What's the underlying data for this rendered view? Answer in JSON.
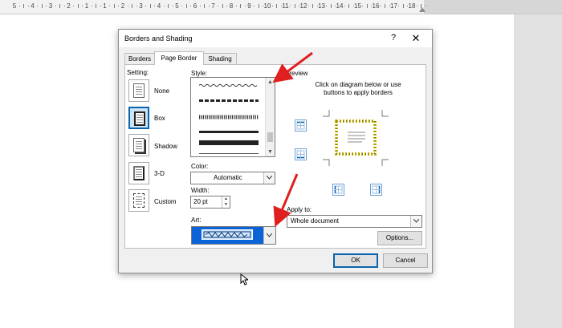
{
  "ruler": {
    "numbers": [
      "5",
      "4",
      "3",
      "2",
      "1",
      "1",
      "2",
      "3",
      "4",
      "5",
      "6",
      "7",
      "8",
      "9",
      "10",
      "11",
      "12",
      "13",
      "14",
      "15",
      "16",
      "17",
      "18"
    ]
  },
  "dialog": {
    "title": "Borders and Shading",
    "help": "?",
    "close": "✕",
    "tabs": [
      "Borders",
      "Page Border",
      "Shading"
    ],
    "active_tab": "Page Border"
  },
  "setting": {
    "label": "Setting:",
    "options": [
      {
        "label": "None"
      },
      {
        "label": "Box"
      },
      {
        "label": "Shadow"
      },
      {
        "label": "3-D"
      },
      {
        "label": "Custom"
      }
    ],
    "selected": "Box"
  },
  "style": {
    "label": "Style:"
  },
  "color": {
    "label": "Color:",
    "value": "Automatic"
  },
  "width": {
    "label": "Width:",
    "value": "20 pt"
  },
  "art": {
    "label": "Art:"
  },
  "preview": {
    "label": "Preview",
    "instructions": "Click on diagram below or use buttons to apply borders"
  },
  "apply_to": {
    "label": "Apply to:",
    "value": "Whole document"
  },
  "buttons": {
    "options": "Options...",
    "ok": "OK",
    "cancel": "Cancel"
  },
  "colors": {
    "accent": "#0a64ad",
    "arrow": "#e02020",
    "art_fill": "#0a64d8"
  }
}
